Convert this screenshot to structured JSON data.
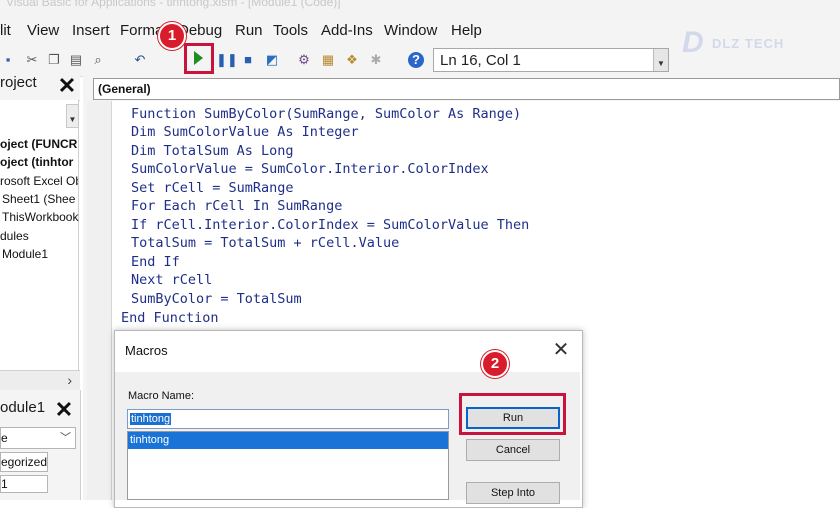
{
  "title_bar": {
    "text": "Visual Basic for Applications - tinhtong.xlsm - [Module1 (Code)]"
  },
  "menu": {
    "items": [
      "lit",
      "View",
      "Insert",
      "Forma",
      "Debug",
      "Run",
      "Tools",
      "Add-Ins",
      "Window",
      "Help"
    ]
  },
  "toolbar": {
    "position_label": "Ln 16, Col 1",
    "run_icon": "play-icon"
  },
  "logo": {
    "mark": "D",
    "text": "DLZ TECH"
  },
  "annotations": {
    "step1": "1",
    "step2": "2",
    "highlight_color": "#c8143c",
    "badge_color": "#d81c2b"
  },
  "project_panel": {
    "title": "roject",
    "items": [
      "oject (FUNCRI",
      "oject (tinhtor",
      "rosoft Excel Ob",
      "Sheet1 (Shee",
      "ThisWorkbook",
      "dules",
      "Module1"
    ]
  },
  "properties_panel": {
    "title": "odule1",
    "combo_value": "e",
    "tab": "egorized",
    "row_value": "1"
  },
  "code_window": {
    "object_combo": "(General)",
    "lines": [
      "Function SumByColor(SumRange, SumColor As Range)",
      "Dim SumColorValue As Integer",
      "Dim TotalSum As Long",
      "SumColorValue = SumColor.Interior.ColorIndex",
      "Set rCell = SumRange",
      "For Each rCell In SumRange",
      "If rCell.Interior.ColorIndex = SumColorValue Then",
      "TotalSum = TotalSum + rCell.Value",
      "End If",
      "Next rCell",
      "SumByColor = TotalSum",
      "End Function"
    ],
    "text_color": "#1f2f88"
  },
  "macros_dialog": {
    "title": "Macros",
    "close": "✕",
    "macro_name_label": "Macro Name:",
    "macro_name_value": "tinhtong",
    "list": [
      "tinhtong"
    ],
    "buttons": {
      "run": "Run",
      "cancel": "Cancel",
      "step_into": "Step Into"
    }
  }
}
